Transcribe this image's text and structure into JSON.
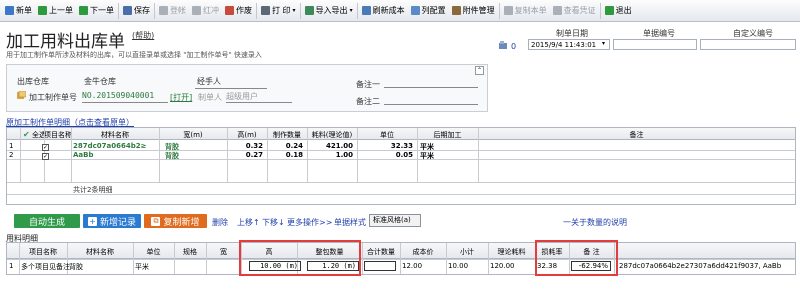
{
  "toolbar": {
    "items": [
      {
        "label": "新单",
        "icon": "new-doc-icon",
        "color": "#3c78c8"
      },
      {
        "label": "上一单",
        "icon": "prev-arrow-icon",
        "color": "#2e9a3e"
      },
      {
        "label": "下一单",
        "icon": "next-arrow-icon",
        "color": "#2e9a3e"
      },
      {
        "label": "保存",
        "icon": "save-disk-icon",
        "color": "#4a6ea8"
      },
      {
        "label": "登帐",
        "icon": "post-ledger-icon",
        "color": "#aab0b8",
        "disabled": true
      },
      {
        "label": "红冲",
        "icon": "red-reverse-icon",
        "color": "#aab0b8",
        "disabled": true
      },
      {
        "label": "作废",
        "icon": "void-icon",
        "color": "#c84a3c"
      },
      {
        "label": "打 印",
        "icon": "printer-icon",
        "color": "#5a6878",
        "dropdown": true
      },
      {
        "label": "导入导出",
        "icon": "import-export-icon",
        "color": "#3c8a5a",
        "dropdown": true
      },
      {
        "label": "刷新成本",
        "icon": "refresh-cost-icon",
        "color": "#4a7ab8"
      },
      {
        "label": "列配置",
        "icon": "column-config-icon",
        "color": "#5a8ac8"
      },
      {
        "label": "附件管理",
        "icon": "attachment-icon",
        "color": "#8a6a3c"
      },
      {
        "label": "复制本单",
        "icon": "copy-doc-icon",
        "color": "#aab0b8",
        "disabled": true
      },
      {
        "label": "查看凭证",
        "icon": "view-voucher-icon",
        "color": "#aab0b8",
        "disabled": true
      },
      {
        "label": "退出",
        "icon": "exit-icon",
        "color": "#2e9a3e"
      }
    ]
  },
  "header": {
    "title": "加工用料出库单",
    "help": "(帮助)",
    "subtitle": "用于加工制作单所涉及材料的出库，可以直接录单或选择 \"加工制作单号\" 快速录入",
    "attach_count": "0",
    "date_label": "制单日期",
    "date_value": "2015/9/4 11:43:01",
    "docno_label": "单据编号",
    "custom_label": "自定义编号"
  },
  "info": {
    "warehouse_label": "出库仓库",
    "warehouse_value": "金牛仓库",
    "handler_label": "经手人",
    "order_label": "加工制作单号",
    "order_value": "NO.201509040001",
    "open_link": "[打开]",
    "maker_label": "制单人",
    "maker_value": "超级用户",
    "note1_label": "备注一",
    "note2_label": "备注二"
  },
  "product_section": {
    "label": "原加工制作单明细（点击查看原单）"
  },
  "product_table": {
    "headers": [
      "",
      "全选",
      "项目名称",
      "材料名称",
      "宽(m)",
      "高(m)",
      "制作数量",
      "耗料(理论值)",
      "单位",
      "后期加工",
      "备注"
    ],
    "rows": [
      {
        "num": "1",
        "name": "287dc07a0664b2≥",
        "material": "背胶",
        "width": "0.32",
        "height": "0.24",
        "qty": "421.00",
        "usage": "32.33",
        "unit": "平米"
      },
      {
        "num": "2",
        "name": "AaBb",
        "material": "背胶",
        "width": "0.27",
        "height": "0.18",
        "qty": "1.00",
        "usage": "0.05",
        "unit": "平米"
      }
    ],
    "footer": "共计2条明细"
  },
  "actions": {
    "auto_gen": "自动生成",
    "new_record": "新增记录",
    "copy_new": "复制新增",
    "delete": "删除",
    "up": "上移↑",
    "down": "下移↓",
    "more": "更多操作>>",
    "style": "单据样式",
    "style_value": "标准风格(a)",
    "quantity_note": "一关于数量的说明"
  },
  "material_section": {
    "label": "用料明细"
  },
  "material_table": {
    "headers": [
      "",
      "项目名称",
      "材料名称",
      "单位",
      "规格",
      "宽",
      "高",
      "整包数量",
      "合计数量",
      "成本价",
      "小计",
      "理论耗料",
      "损耗率",
      "备 注"
    ],
    "rows": [
      {
        "num": "1",
        "project": "多个项目见备注",
        "material": "背胶",
        "unit": "平米",
        "spec": "",
        "width": "10.00 (m)",
        "height": "1.20 (m)",
        "pack": "",
        "total": "12.00",
        "cost": "10.00",
        "subtotal": "120.00",
        "theory": "32.38",
        "loss": "-62.94%",
        "note": "287dc07a0664b2e27307a6dd421f9037, AaBb"
      }
    ]
  }
}
